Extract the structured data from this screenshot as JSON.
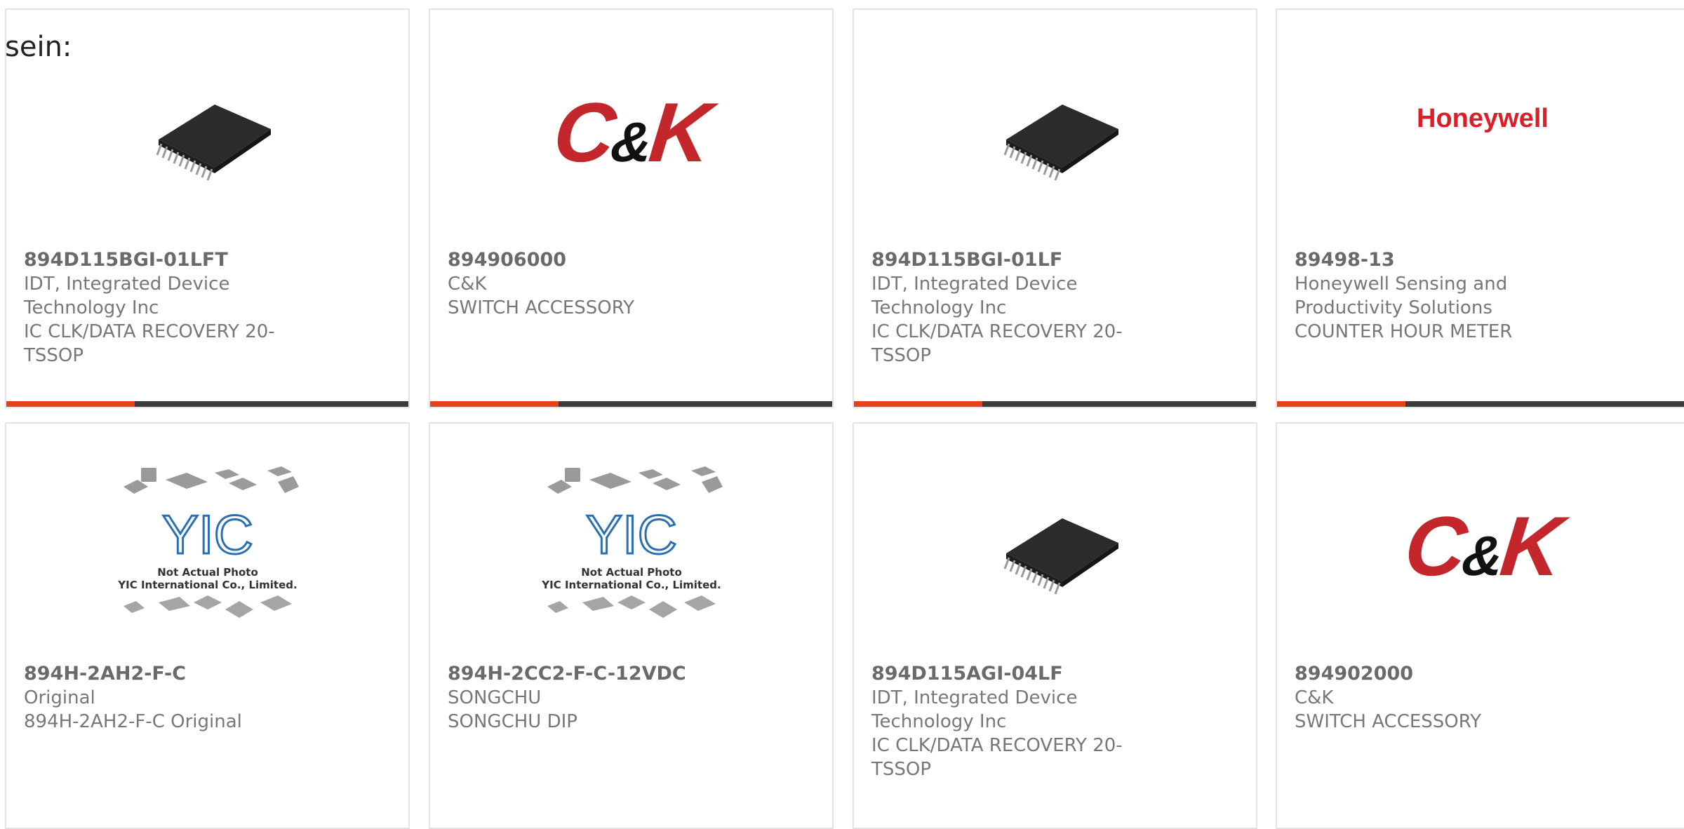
{
  "lead_text": "sein:",
  "products": [
    {
      "part_number": "894D115BGI-01LFT",
      "manufacturer": "IDT, Integrated Device Technology Inc",
      "description": "IC CLK/DATA RECOVERY 20-TSSOP",
      "image": "chip-tssop-icon"
    },
    {
      "part_number": "894906000",
      "manufacturer": "C&K",
      "description": "SWITCH ACCESSORY",
      "image": "ck-logo",
      "logo_text": "C&K"
    },
    {
      "part_number": "894D115BGI-01LF",
      "manufacturer": "IDT, Integrated Device Technology Inc",
      "description": "IC CLK/DATA RECOVERY 20-TSSOP",
      "image": "chip-tssop-icon"
    },
    {
      "part_number": "89498-13",
      "manufacturer": "Honeywell Sensing and Productivity Solutions",
      "description": "COUNTER HOUR METER",
      "image": "honeywell-logo",
      "logo_text": "Honeywell"
    },
    {
      "part_number": "894H-2AH2-F-C",
      "manufacturer": "Original",
      "description": "894H-2AH2-F-C Original",
      "image": "yic-placeholder",
      "placeholder_line1": "Not Actual Photo",
      "placeholder_line2": "YIC International Co., Limited.",
      "placeholder_logo": "YIC"
    },
    {
      "part_number": "894H-2CC2-F-C-12VDC",
      "manufacturer": "SONGCHU",
      "description": "SONGCHU DIP",
      "image": "yic-placeholder",
      "placeholder_line1": "Not Actual Photo",
      "placeholder_line2": "YIC International Co., Limited.",
      "placeholder_logo": "YIC"
    },
    {
      "part_number": "894D115AGI-04LF",
      "manufacturer": "IDT, Integrated Device Technology Inc",
      "description": "IC CLK/DATA RECOVERY 20-TSSOP",
      "image": "chip-tssop-icon"
    },
    {
      "part_number": "894902000",
      "manufacturer": "C&K",
      "description": "SWITCH ACCESSORY",
      "image": "ck-logo",
      "logo_text": "C&K"
    }
  ],
  "colors": {
    "accent_bar": "#e8401c",
    "bar_base": "#3b3b3b",
    "card_border": "#e3e3e3",
    "text_muted": "#777777",
    "ck_red": "#c4272b",
    "honeywell_red": "#dc1f26"
  }
}
